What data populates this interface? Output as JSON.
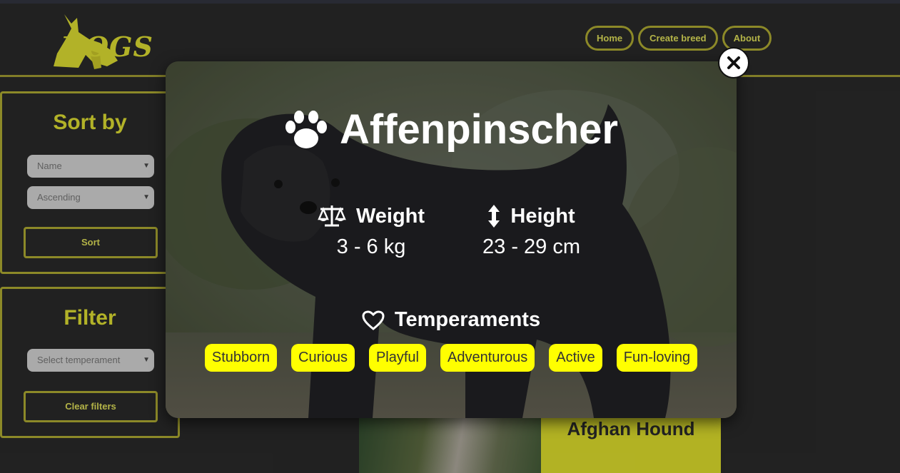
{
  "brand": {
    "logo_text": "DOGS"
  },
  "nav": {
    "items": [
      "Home",
      "Create breed",
      "About"
    ]
  },
  "sort_panel": {
    "title": "Sort by",
    "field_select": "Name",
    "order_select": "Ascending",
    "button": "Sort"
  },
  "filter_panel": {
    "title": "Filter",
    "temperament_select": "Select temperament",
    "button": "Clear filters"
  },
  "background_card": {
    "name": "Afghan Hound"
  },
  "modal": {
    "title": "Affenpinscher",
    "title_icon": "paw-icon",
    "weight": {
      "label": "Weight",
      "value": "3 - 6 kg",
      "icon": "scale-icon"
    },
    "height": {
      "label": "Height",
      "value": "23 - 29 cm",
      "icon": "vertical-arrows-icon"
    },
    "temperaments_label": "Temperaments",
    "temperaments_icon": "heart-icon",
    "temperaments": [
      "Stubborn",
      "Curious",
      "Playful",
      "Adventurous",
      "Active",
      "Fun-loving"
    ],
    "close_icon": "close-icon"
  },
  "colors": {
    "accent_yellow": "#ffff00",
    "page_bg": "#303030",
    "border_yellow": "#c9c43a"
  }
}
